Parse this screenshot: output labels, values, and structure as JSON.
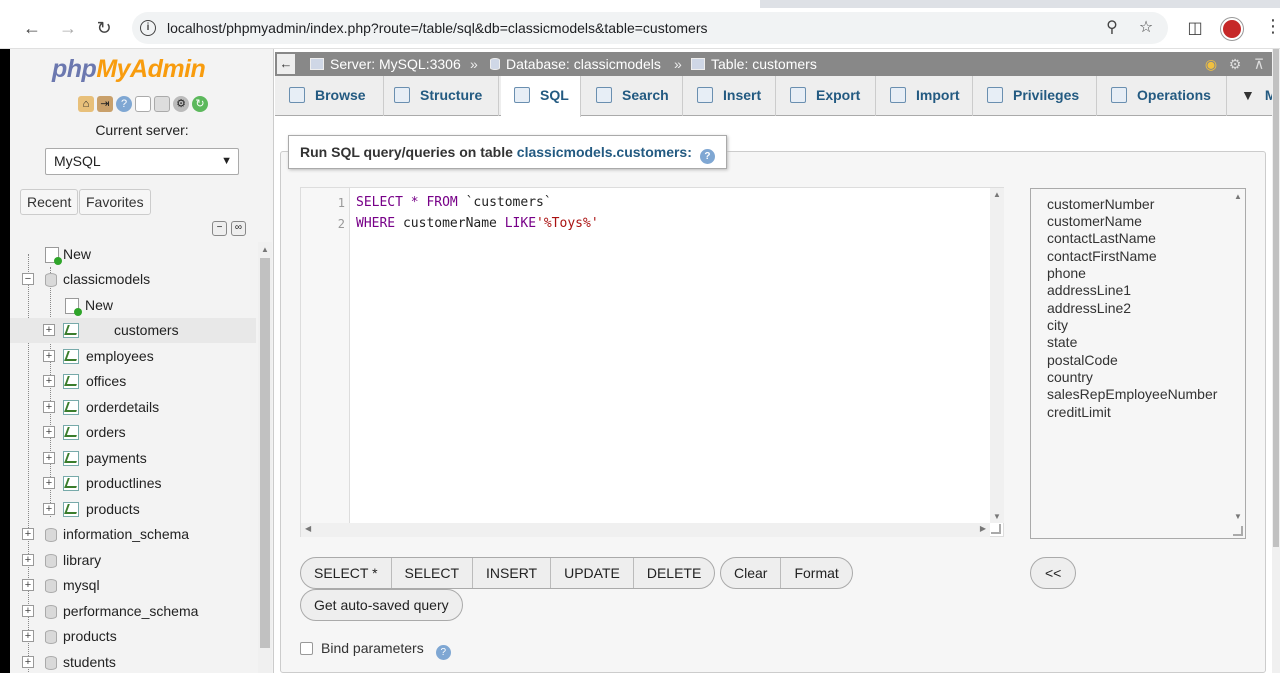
{
  "browser": {
    "url": "localhost/phpmyadmin/index.php?route=/table/sql&db=classicmodels&table=customers"
  },
  "nav": {
    "logo_php": "php",
    "logo_myadmin": "MyAdmin",
    "current_server_label": "Current server:",
    "server_selected": "MySQL",
    "tabs": [
      "Recent",
      "Favorites"
    ],
    "tree": [
      {
        "label": "New"
      },
      {
        "label": "classicmodels"
      },
      {
        "label": "New"
      },
      {
        "label": "customers"
      },
      {
        "label": "employees"
      },
      {
        "label": "offices"
      },
      {
        "label": "orderdetails"
      },
      {
        "label": "orders"
      },
      {
        "label": "payments"
      },
      {
        "label": "productlines"
      },
      {
        "label": "products"
      },
      {
        "label": "information_schema"
      },
      {
        "label": "library"
      },
      {
        "label": "mysql"
      },
      {
        "label": "performance_schema"
      },
      {
        "label": "products"
      },
      {
        "label": "students"
      }
    ]
  },
  "breadcrumb": {
    "server": "Server: MySQL:3306",
    "database": "Database: classicmodels",
    "table": "Table: customers",
    "separator": "»"
  },
  "menu": [
    "Browse",
    "Structure",
    "SQL",
    "Search",
    "Insert",
    "Export",
    "Import",
    "Privileges",
    "Operations",
    "M"
  ],
  "sql": {
    "legend_prefix": "Run SQL query/queries on table",
    "legend_table": "classicmodels.customers:",
    "line_numbers": [
      "1",
      "2"
    ],
    "line1": {
      "kw1": "SELECT",
      "op": "*",
      "kw2": "FROM",
      "tbl": "`customers`"
    },
    "line2": {
      "kw1": "WHERE",
      "col": "customerName",
      "kw2": "LIKE",
      "str": "'%Toys%'"
    },
    "columns": [
      "customerNumber",
      "customerName",
      "contactLastName",
      "contactFirstName",
      "phone",
      "addressLine1",
      "addressLine2",
      "city",
      "state",
      "postalCode",
      "country",
      "salesRepEmployeeNumber",
      "creditLimit"
    ],
    "buttons_group1": [
      "SELECT *",
      "SELECT",
      "INSERT",
      "UPDATE",
      "DELETE"
    ],
    "buttons_group2": [
      "Clear",
      "Format"
    ],
    "insert_button": "<<",
    "autosave_button": "Get auto-saved query",
    "bind_label": "Bind parameters"
  },
  "colors": {
    "accent": "#235a81",
    "logo_php": "#6c78af",
    "logo_myadmin": "#f89c0e"
  }
}
